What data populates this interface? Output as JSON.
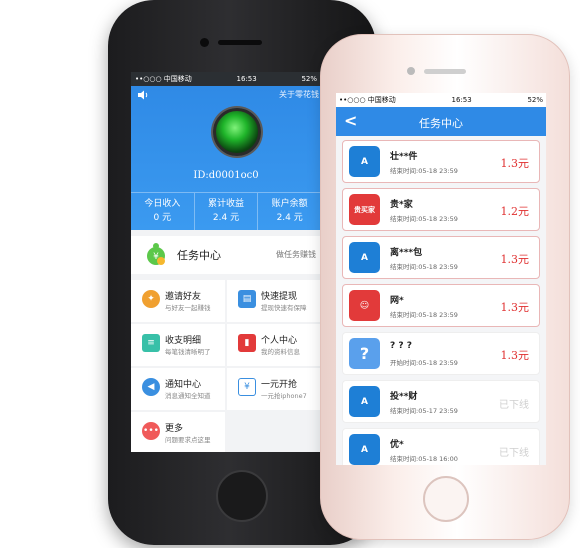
{
  "back_phone": {
    "status": {
      "carrier": "••○○○ 中国移动",
      "time": "16:53",
      "battery": "52%"
    },
    "header": {
      "about_link": "关于零花钱",
      "user_id": "ID:d0001oc0"
    },
    "stats": [
      {
        "label": "今日收入",
        "value": "0 元"
      },
      {
        "label": "累计收益",
        "value": "2.4 元"
      },
      {
        "label": "账户余额",
        "value": "2.4 元"
      }
    ],
    "task_center": {
      "title": "任务中心",
      "subtitle": "做任务赚钱"
    },
    "menu": [
      {
        "title": "邀请好友",
        "subtitle": "与好友一起赚钱",
        "icon": "gift-icon",
        "color": "#f0a030"
      },
      {
        "title": "快速提现",
        "subtitle": "提现快速有保障",
        "icon": "wallet-icon",
        "color": "#3a8fe0"
      },
      {
        "title": "收支明细",
        "subtitle": "每笔钱清晰明了",
        "icon": "document-icon",
        "color": "#38c0a8"
      },
      {
        "title": "个人中心",
        "subtitle": "我的资料信息",
        "icon": "person-icon",
        "color": "#e23a3a"
      },
      {
        "title": "通知中心",
        "subtitle": "消息通知全知道",
        "icon": "megaphone-icon",
        "color": "#3a8fe0"
      },
      {
        "title": "一元开抢",
        "subtitle": "一元抢iphone7",
        "icon": "coin-icon",
        "color": "#3a8fe0"
      },
      {
        "title": "更多",
        "subtitle": "问题要求点这里",
        "icon": "more-icon",
        "color": "#f05a5a"
      }
    ]
  },
  "front_phone": {
    "status": {
      "carrier": "••○○○ 中国移动",
      "time": "16:53",
      "battery": "52%"
    },
    "nav": {
      "back": "<",
      "title": "任务中心"
    },
    "tasks": [
      {
        "name": "壮**件",
        "time": "结束时间:05-18 23:59",
        "price": "1.3元",
        "icon": "app-store-icon",
        "color": "#1e7fd6",
        "bordered": true
      },
      {
        "name": "贵*家",
        "time": "结束时间:05-18 23:59",
        "price": "1.2元",
        "icon": "guimaijia-icon",
        "color": "#e23a3a",
        "bordered": true,
        "icon_text": "贵买家"
      },
      {
        "name": "离***包",
        "time": "结束时间:05-18 23:59",
        "price": "1.3元",
        "icon": "app-store-icon",
        "color": "#1e7fd6",
        "bordered": true
      },
      {
        "name": "网*",
        "time": "结束时间:05-18 23:59",
        "price": "1.3元",
        "icon": "mascot-icon",
        "color": "#e23a3a",
        "bordered": true
      },
      {
        "name": "? ? ?",
        "time": "开始时间:05-18 23:59",
        "price": "1.3元",
        "icon": "question-icon",
        "color": "#5aa0ec",
        "bordered": false
      },
      {
        "name": "投**财",
        "time": "结束时间:05-17 23:59",
        "status": "已下线",
        "icon": "app-store-icon",
        "color": "#1e7fd6",
        "bordered": false
      },
      {
        "name": "优*",
        "time": "结束时间:05-18 16:00",
        "status": "已下线",
        "icon": "app-store-icon",
        "color": "#1e7fd6",
        "bordered": false
      }
    ]
  }
}
